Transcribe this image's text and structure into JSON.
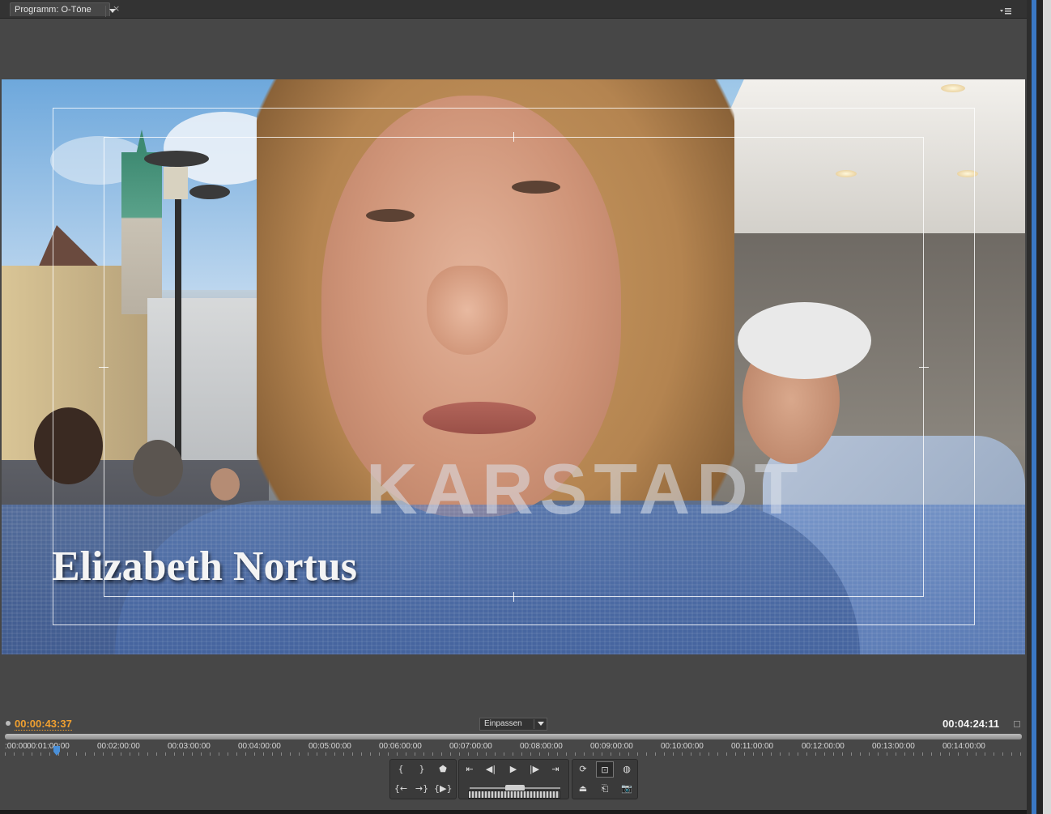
{
  "panel": {
    "tab_label": "Programm: O-Töne",
    "close_glyph": "×",
    "menu_icon": "panel-menu-icon"
  },
  "video": {
    "lower_third_name": "Elizabeth Nortus",
    "background_text": "KARSTADT"
  },
  "transport": {
    "current_timecode": "00:00:43:37",
    "duration_timecode": "00:04:24:11",
    "zoom_select_value": "Einpassen",
    "ruler_labels": [
      ":00:00",
      "00:01:00:00",
      "00:02:00:00",
      "00:03:00:00",
      "00:04:00:00",
      "00:05:00:00",
      "00:06:00:00",
      "00:07:00:00",
      "00:08:00:00",
      "00:09:00:00",
      "00:10:00:00",
      "00:11:00:00",
      "00:12:00:00",
      "00:13:00:00",
      "00:14:00:00"
    ],
    "playhead_fraction": 0.048
  },
  "colors": {
    "current_timecode": "#f0a030",
    "selection_strip": "#3a78c4"
  }
}
